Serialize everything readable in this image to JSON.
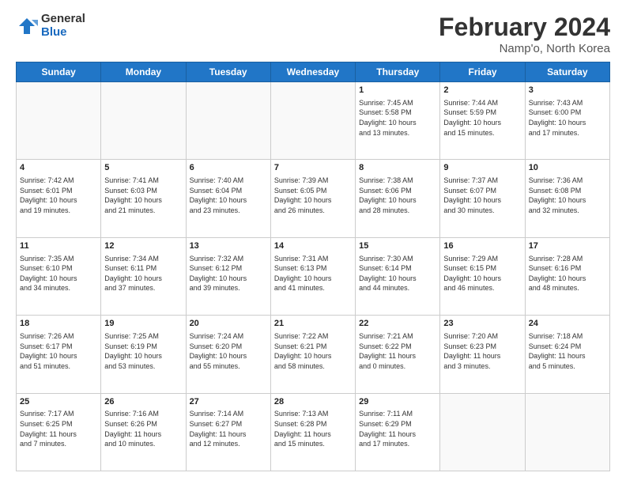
{
  "header": {
    "logo_general": "General",
    "logo_blue": "Blue",
    "title": "February 2024",
    "location": "Namp'o, North Korea"
  },
  "weekdays": [
    "Sunday",
    "Monday",
    "Tuesday",
    "Wednesday",
    "Thursday",
    "Friday",
    "Saturday"
  ],
  "weeks": [
    [
      {
        "day": "",
        "info": ""
      },
      {
        "day": "",
        "info": ""
      },
      {
        "day": "",
        "info": ""
      },
      {
        "day": "",
        "info": ""
      },
      {
        "day": "1",
        "info": "Sunrise: 7:45 AM\nSunset: 5:58 PM\nDaylight: 10 hours\nand 13 minutes."
      },
      {
        "day": "2",
        "info": "Sunrise: 7:44 AM\nSunset: 5:59 PM\nDaylight: 10 hours\nand 15 minutes."
      },
      {
        "day": "3",
        "info": "Sunrise: 7:43 AM\nSunset: 6:00 PM\nDaylight: 10 hours\nand 17 minutes."
      }
    ],
    [
      {
        "day": "4",
        "info": "Sunrise: 7:42 AM\nSunset: 6:01 PM\nDaylight: 10 hours\nand 19 minutes."
      },
      {
        "day": "5",
        "info": "Sunrise: 7:41 AM\nSunset: 6:03 PM\nDaylight: 10 hours\nand 21 minutes."
      },
      {
        "day": "6",
        "info": "Sunrise: 7:40 AM\nSunset: 6:04 PM\nDaylight: 10 hours\nand 23 minutes."
      },
      {
        "day": "7",
        "info": "Sunrise: 7:39 AM\nSunset: 6:05 PM\nDaylight: 10 hours\nand 26 minutes."
      },
      {
        "day": "8",
        "info": "Sunrise: 7:38 AM\nSunset: 6:06 PM\nDaylight: 10 hours\nand 28 minutes."
      },
      {
        "day": "9",
        "info": "Sunrise: 7:37 AM\nSunset: 6:07 PM\nDaylight: 10 hours\nand 30 minutes."
      },
      {
        "day": "10",
        "info": "Sunrise: 7:36 AM\nSunset: 6:08 PM\nDaylight: 10 hours\nand 32 minutes."
      }
    ],
    [
      {
        "day": "11",
        "info": "Sunrise: 7:35 AM\nSunset: 6:10 PM\nDaylight: 10 hours\nand 34 minutes."
      },
      {
        "day": "12",
        "info": "Sunrise: 7:34 AM\nSunset: 6:11 PM\nDaylight: 10 hours\nand 37 minutes."
      },
      {
        "day": "13",
        "info": "Sunrise: 7:32 AM\nSunset: 6:12 PM\nDaylight: 10 hours\nand 39 minutes."
      },
      {
        "day": "14",
        "info": "Sunrise: 7:31 AM\nSunset: 6:13 PM\nDaylight: 10 hours\nand 41 minutes."
      },
      {
        "day": "15",
        "info": "Sunrise: 7:30 AM\nSunset: 6:14 PM\nDaylight: 10 hours\nand 44 minutes."
      },
      {
        "day": "16",
        "info": "Sunrise: 7:29 AM\nSunset: 6:15 PM\nDaylight: 10 hours\nand 46 minutes."
      },
      {
        "day": "17",
        "info": "Sunrise: 7:28 AM\nSunset: 6:16 PM\nDaylight: 10 hours\nand 48 minutes."
      }
    ],
    [
      {
        "day": "18",
        "info": "Sunrise: 7:26 AM\nSunset: 6:17 PM\nDaylight: 10 hours\nand 51 minutes."
      },
      {
        "day": "19",
        "info": "Sunrise: 7:25 AM\nSunset: 6:19 PM\nDaylight: 10 hours\nand 53 minutes."
      },
      {
        "day": "20",
        "info": "Sunrise: 7:24 AM\nSunset: 6:20 PM\nDaylight: 10 hours\nand 55 minutes."
      },
      {
        "day": "21",
        "info": "Sunrise: 7:22 AM\nSunset: 6:21 PM\nDaylight: 10 hours\nand 58 minutes."
      },
      {
        "day": "22",
        "info": "Sunrise: 7:21 AM\nSunset: 6:22 PM\nDaylight: 11 hours\nand 0 minutes."
      },
      {
        "day": "23",
        "info": "Sunrise: 7:20 AM\nSunset: 6:23 PM\nDaylight: 11 hours\nand 3 minutes."
      },
      {
        "day": "24",
        "info": "Sunrise: 7:18 AM\nSunset: 6:24 PM\nDaylight: 11 hours\nand 5 minutes."
      }
    ],
    [
      {
        "day": "25",
        "info": "Sunrise: 7:17 AM\nSunset: 6:25 PM\nDaylight: 11 hours\nand 7 minutes."
      },
      {
        "day": "26",
        "info": "Sunrise: 7:16 AM\nSunset: 6:26 PM\nDaylight: 11 hours\nand 10 minutes."
      },
      {
        "day": "27",
        "info": "Sunrise: 7:14 AM\nSunset: 6:27 PM\nDaylight: 11 hours\nand 12 minutes."
      },
      {
        "day": "28",
        "info": "Sunrise: 7:13 AM\nSunset: 6:28 PM\nDaylight: 11 hours\nand 15 minutes."
      },
      {
        "day": "29",
        "info": "Sunrise: 7:11 AM\nSunset: 6:29 PM\nDaylight: 11 hours\nand 17 minutes."
      },
      {
        "day": "",
        "info": ""
      },
      {
        "day": "",
        "info": ""
      }
    ]
  ]
}
